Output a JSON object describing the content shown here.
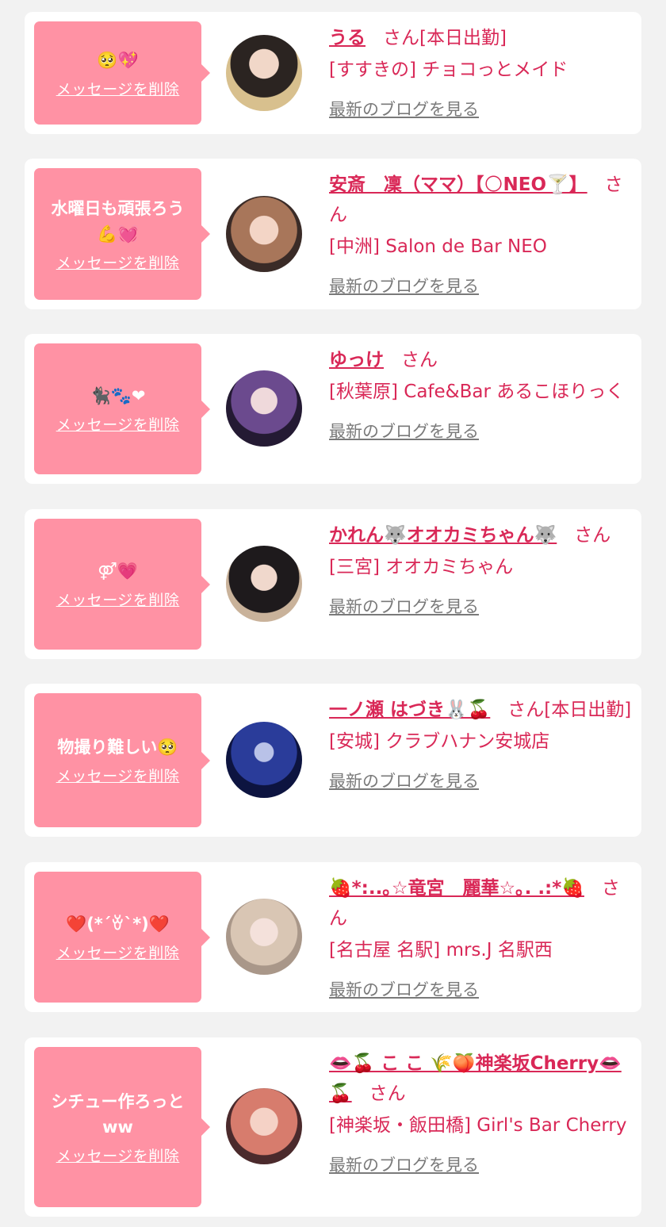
{
  "delete_label": "メッセージを削除",
  "san_label": "さん",
  "blog_label": "最新のブログを見る",
  "accent_color": "#ff92a4",
  "text_color": "#d92857",
  "cards": [
    {
      "message": "🥺💖",
      "name": "うる",
      "suffix": "さん[本日出勤]",
      "shop": "[すすきの] チョコっとメイド",
      "avatar": "avatar-1"
    },
    {
      "message": "水曜日も頑張ろう💪💓",
      "name": "安斎　凜（ママ）【🌕NEO🍸】",
      "suffix": "さん",
      "shop": "[中洲] Salon de Bar NEO",
      "avatar": "avatar-2"
    },
    {
      "message": "🐈‍⬛🐾❤",
      "name": "ゆっけ",
      "suffix": "さん",
      "shop": "[秋葉原] Cafe&Bar あるこほりっく",
      "avatar": "avatar-3"
    },
    {
      "message": "⚤💗",
      "name": "かれん🐺オオカミちゃん🐺",
      "suffix": "さん",
      "shop": "[三宮] オオカミちゃん",
      "avatar": "avatar-4"
    },
    {
      "message": "物撮り難しい🥺",
      "name": "一ノ瀬 はづき🐰🍒",
      "suffix": "さん[本日出勤]",
      "shop": "[安城] クラブハナン安城店",
      "avatar": "avatar-5"
    },
    {
      "message": "❤️(*´ꈊ`*)❤️",
      "name": "🍓*:..｡☆竜宮　麗華☆｡. .:*🍓",
      "suffix": "さん",
      "shop": "[名古屋 名駅] mrs.J 名駅西",
      "avatar": "avatar-6"
    },
    {
      "message": "シチュー作ろっとww",
      "name": "👄🍒 こ こ 🌾🍑神楽坂Cherry👄🍒",
      "suffix": "さん",
      "shop": "[神楽坂・飯田橋] Girl's Bar Cherry",
      "avatar": "avatar-7"
    }
  ]
}
